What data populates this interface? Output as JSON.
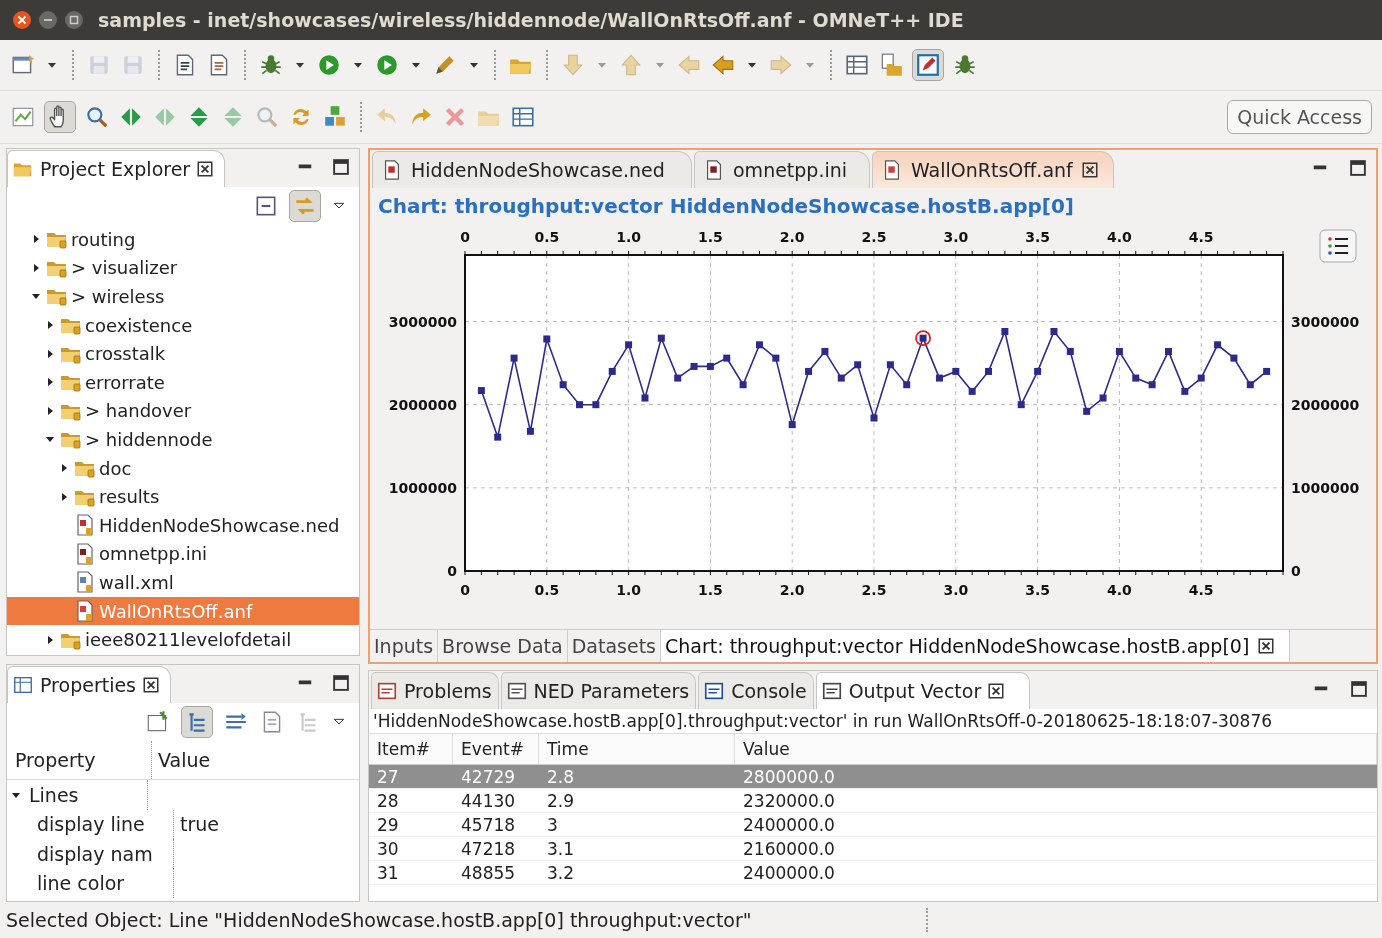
{
  "window": {
    "title": "samples - inet/showcases/wireless/hiddennode/WallOnRtsOff.anf - OMNeT++ IDE"
  },
  "quick_access": {
    "label": "Quick Access"
  },
  "project_explorer": {
    "title": "Project Explorer",
    "tree": [
      {
        "label": "routing",
        "kind": "folder",
        "expanded": false,
        "selected": false
      },
      {
        "label": "> visualizer",
        "kind": "folder",
        "expanded": false,
        "selected": false
      },
      {
        "label": "> wireless",
        "kind": "folder",
        "expanded": true,
        "selected": false,
        "children": [
          {
            "label": "coexistence",
            "kind": "folder",
            "expanded": false,
            "selected": false
          },
          {
            "label": "crosstalk",
            "kind": "folder",
            "expanded": false,
            "selected": false
          },
          {
            "label": "errorrate",
            "kind": "folder",
            "expanded": false,
            "selected": false
          },
          {
            "label": "> handover",
            "kind": "folder",
            "expanded": false,
            "selected": false
          },
          {
            "label": "> hiddennode",
            "kind": "folder",
            "expanded": true,
            "selected": false,
            "children": [
              {
                "label": "doc",
                "kind": "folder",
                "expanded": false,
                "selected": false
              },
              {
                "label": "results",
                "kind": "folder",
                "expanded": false,
                "selected": false
              },
              {
                "label": "HiddenNodeShowcase.ned",
                "kind": "ned",
                "selected": false
              },
              {
                "label": "omnetpp.ini",
                "kind": "ini",
                "selected": false
              },
              {
                "label": "wall.xml",
                "kind": "xml",
                "selected": false
              },
              {
                "label": "WallOnRtsOff.anf",
                "kind": "anf",
                "selected": true
              }
            ]
          },
          {
            "label": "ieee80211levelofdetail",
            "kind": "folder",
            "expanded": false,
            "selected": false
          }
        ]
      }
    ]
  },
  "properties": {
    "title": "Properties",
    "columns": [
      "Property",
      "Value"
    ],
    "rows": [
      {
        "property": "Lines",
        "expanded": true,
        "children": [
          {
            "property": "display line",
            "value": "true"
          },
          {
            "property": "display nam"
          },
          {
            "property": "line color"
          }
        ]
      }
    ]
  },
  "editor": {
    "tabs": [
      {
        "label": "HiddenNodeShowcase.ned",
        "kind": "ned",
        "selected": false
      },
      {
        "label": "omnetpp.ini",
        "kind": "ini",
        "selected": false
      },
      {
        "label": "WallOnRtsOff.anf",
        "kind": "anf",
        "selected": true
      }
    ],
    "chart_title": "Chart: throughput:vector HiddenNodeShowcase.hostB.app[0]",
    "chart_data": {
      "type": "line",
      "x": [
        0.1,
        0.2,
        0.3,
        0.4,
        0.5,
        0.6,
        0.7,
        0.8,
        0.9,
        1.0,
        1.1,
        1.2,
        1.3,
        1.4,
        1.5,
        1.6,
        1.7,
        1.8,
        1.9,
        2.0,
        2.1,
        2.2,
        2.3,
        2.4,
        2.5,
        2.6,
        2.7,
        2.8,
        2.9,
        3.0,
        3.1,
        3.2,
        3.3,
        3.4,
        3.5,
        3.6,
        3.7,
        3.8,
        3.9,
        4.0,
        4.1,
        4.2,
        4.3,
        4.4,
        4.5,
        4.6,
        4.7,
        4.8,
        4.9
      ],
      "series": [
        {
          "color": "#2e2a8c",
          "marker": "square",
          "values": [
            2170000,
            1610000,
            2560000,
            1680000,
            2790000,
            2240000,
            2000000,
            2000000,
            2400000,
            2720000,
            2080000,
            2800000,
            2320000,
            2460000,
            2460000,
            2560000,
            2240000,
            2720000,
            2560000,
            1760000,
            2400000,
            2640000,
            2320000,
            2480000,
            1840000,
            2480000,
            2240000,
            2800000,
            2320000,
            2400000,
            2160000,
            2400000,
            2880000,
            2000000,
            2400000,
            2880000,
            2640000,
            1920000,
            2080000,
            2640000,
            2320000,
            2240000,
            2640000,
            2160000,
            2320000,
            2720000,
            2560000,
            2240000,
            2400000
          ]
        }
      ],
      "xlim": [
        0,
        5
      ],
      "ylim": [
        0,
        3800000
      ],
      "xticks": [
        {
          "value": 0,
          "label": "0"
        },
        {
          "value": 0.5,
          "label": "0.5"
        },
        {
          "value": 1,
          "label": "1.0"
        },
        {
          "value": 1.5,
          "label": "1.5"
        },
        {
          "value": 2,
          "label": "2.0"
        },
        {
          "value": 2.5,
          "label": "2.5"
        },
        {
          "value": 3,
          "label": "3.0"
        },
        {
          "value": 3.5,
          "label": "3.5"
        },
        {
          "value": 4,
          "label": "4.0"
        },
        {
          "value": 4.5,
          "label": "4.5"
        }
      ],
      "yticks": [
        0,
        1000000,
        2000000,
        3000000
      ],
      "y2ticks": [
        0,
        1000000,
        2000000,
        3000000
      ],
      "y2lim": [
        0,
        3800000
      ],
      "grid": true
    },
    "pages": [
      {
        "label": "Inputs",
        "selected": false
      },
      {
        "label": "Browse Data",
        "selected": false
      },
      {
        "label": "Datasets",
        "selected": false
      },
      {
        "label": "Chart: throughput:vector HiddenNodeShowcase.hostB.app[0]",
        "selected": true
      }
    ]
  },
  "views": {
    "tabs": [
      {
        "label": "Problems",
        "kind": "problems",
        "selected": false
      },
      {
        "label": "NED Parameters",
        "kind": "params",
        "selected": false
      },
      {
        "label": "Console",
        "kind": "console",
        "selected": false
      },
      {
        "label": "Output Vector",
        "kind": "vector",
        "selected": true
      }
    ],
    "header": "'HiddenNodeShowcase.hostB.app[0].throughput:vector' in run WallOnRtsOff-0-20180625-18:18:07-30876",
    "columns": [
      "Item#",
      "Event#",
      "Time",
      "Value"
    ],
    "rows": [
      {
        "cells": [
          "27",
          "42729",
          "2.8",
          "2800000.0"
        ],
        "selected": true
      },
      {
        "cells": [
          "28",
          "44130",
          "2.9",
          "2320000.0"
        ],
        "selected": false
      },
      {
        "cells": [
          "29",
          "45718",
          "3",
          "2400000.0"
        ],
        "selected": false
      },
      {
        "cells": [
          "30",
          "47218",
          "3.1",
          "2160000.0"
        ],
        "selected": false
      },
      {
        "cells": [
          "31",
          "48855",
          "3.2",
          "2400000.0"
        ],
        "selected": false
      }
    ]
  },
  "status_bar": {
    "text": "Selected Object: Line \"HiddenNodeShowcase.hostB.app[0] throughput:vector\""
  }
}
